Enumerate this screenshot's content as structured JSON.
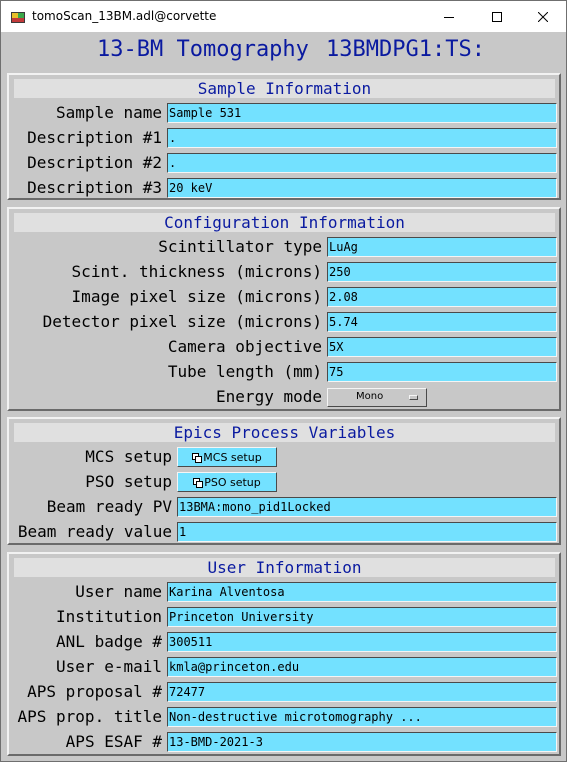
{
  "window": {
    "title": "tomoScan_13BM.adl@corvette"
  },
  "header": {
    "title": "13-BM Tomography",
    "prefix": "13BMDPG1:TS:"
  },
  "sample": {
    "section_title": "Sample Information",
    "rows": [
      {
        "label": "Sample name",
        "value": "Sample 531"
      },
      {
        "label": "Description #1",
        "value": "."
      },
      {
        "label": "Description #2",
        "value": "."
      },
      {
        "label": "Description #3",
        "value": "20 keV"
      }
    ]
  },
  "config": {
    "section_title": "Configuration Information",
    "rows": [
      {
        "label": "Scintillator type",
        "value": "LuAg"
      },
      {
        "label": "Scint. thickness (microns)",
        "value": "250"
      },
      {
        "label": "Image pixel size (microns)",
        "value": "2.08"
      },
      {
        "label": "Detector pixel size (microns)",
        "value": "5.74"
      },
      {
        "label": "Camera objective",
        "value": "5X"
      },
      {
        "label": "Tube length (mm)",
        "value": "75"
      }
    ],
    "energy_label": "Energy mode",
    "energy_value": "Mono"
  },
  "epics": {
    "section_title": "Epics Process Variables",
    "mcs_label": "MCS setup",
    "mcs_button": "MCS setup",
    "pso_label": "PSO setup",
    "pso_button": "PSO setup",
    "beam_pv_label": "Beam ready PV",
    "beam_pv_value": "13BMA:mono_pid1Locked",
    "beam_value_label": "Beam ready value",
    "beam_value_value": "1"
  },
  "user": {
    "section_title": "User Information",
    "rows": [
      {
        "label": "User name",
        "value": "Karina Alventosa"
      },
      {
        "label": "Institution",
        "value": "Princeton University"
      },
      {
        "label": "ANL badge #",
        "value": "300511"
      },
      {
        "label": "User e-mail",
        "value": "kmla@princeton.edu"
      },
      {
        "label": "APS proposal #",
        "value": "72477"
      },
      {
        "label": "APS prop. title",
        "value": "Non-destructive microtomography ..."
      },
      {
        "label": "APS ESAF #",
        "value": "13-BMD-2021-3"
      }
    ]
  },
  "colors": {
    "field_bg": "#73e1ff",
    "title_text": "#0a1aa0",
    "panel_bg": "#c8c8c8",
    "section_bar": "#e0e0e0"
  },
  "icons": {
    "app": "medm-app-icon",
    "minimize": "minimize-icon",
    "maximize": "maximize-icon",
    "close": "close-icon",
    "related_display": "related-display-icon"
  }
}
